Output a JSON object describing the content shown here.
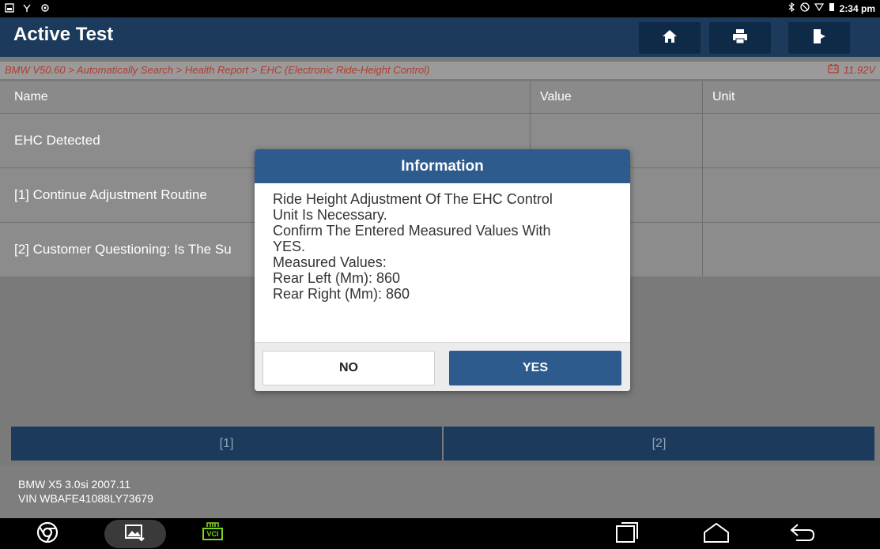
{
  "status": {
    "time": "2:34 pm"
  },
  "header": {
    "title": "Active Test"
  },
  "breadcrumb": "BMW V50.60 > Automatically Search > Health Report > EHC (Electronic Ride-Height Control)",
  "voltage": "11.92V",
  "table": {
    "columns": [
      "Name",
      "Value",
      "Unit"
    ],
    "rows": [
      {
        "name": "EHC Detected",
        "value": "",
        "unit": ""
      },
      {
        "name": "[1] Continue Adjustment Routine",
        "value": "",
        "unit": ""
      },
      {
        "name": "[2] Customer Questioning: Is The Su",
        "value": "",
        "unit": ""
      }
    ]
  },
  "bottom_buttons": [
    "[1]",
    "[2]"
  ],
  "vehicle": {
    "model": "BMW X5 3.0si 2007.11",
    "vin": "VIN WBAFE41088LY73679"
  },
  "dialog": {
    "title": "Information",
    "lines": [
      "Ride Height Adjustment Of The EHC Control",
      "Unit Is Necessary.",
      "Confirm The Entered Measured Values With",
      "YES.",
      "Measured Values:",
      "Rear Left (Mm): 860",
      "Rear Right (Mm): 860"
    ],
    "no_label": "NO",
    "yes_label": "YES"
  },
  "navbar": {
    "vci_label": "VCI"
  },
  "colors": {
    "header": "#1b3a5c",
    "accent": "#2e5b8e",
    "breadcrumb": "#b33b2e"
  }
}
